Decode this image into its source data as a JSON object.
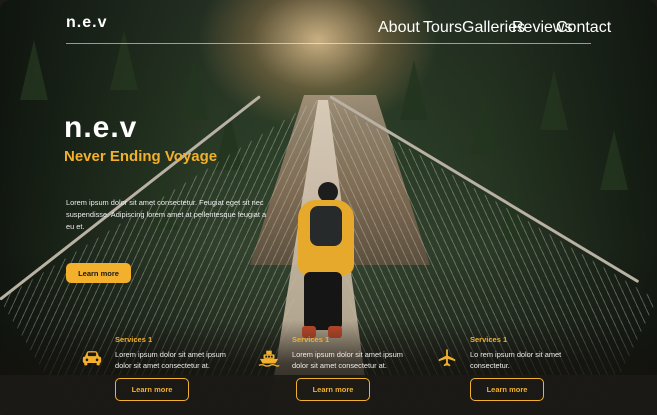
{
  "brand": "n.e.v",
  "nav": [
    "About",
    "Tours",
    "Galleries",
    "Reviews",
    "Contact"
  ],
  "hero": {
    "title": "n.e.v",
    "subtitle": "Never Ending Voyage",
    "description": "Lorem ipsum dolor sit amet consectetur. Feugiat eget sit nec suspendisse. Adipiscing lorem amet at pellentesque feugiat a eu et.",
    "cta": "Learn more"
  },
  "services": [
    {
      "icon": "car-icon",
      "title": "Services 1",
      "text": "Lorem ipsum dolor sit amet ipsum dolor sit amet consectetur at.",
      "cta": "Learn more"
    },
    {
      "icon": "boat-icon",
      "title": "Services 1",
      "text": "Lorem ipsum dolor sit amet ipsum dolor sit amet consectetur at.",
      "cta": "Learn more"
    },
    {
      "icon": "airplane-icon",
      "title": "Services 1",
      "text": "Lo rem ipsum dolor sit amet consectetur.",
      "cta": "Learn more"
    }
  ],
  "colors": {
    "accent": "#f2b02c",
    "text": "#ffffff",
    "bar": "#1c1a16"
  }
}
